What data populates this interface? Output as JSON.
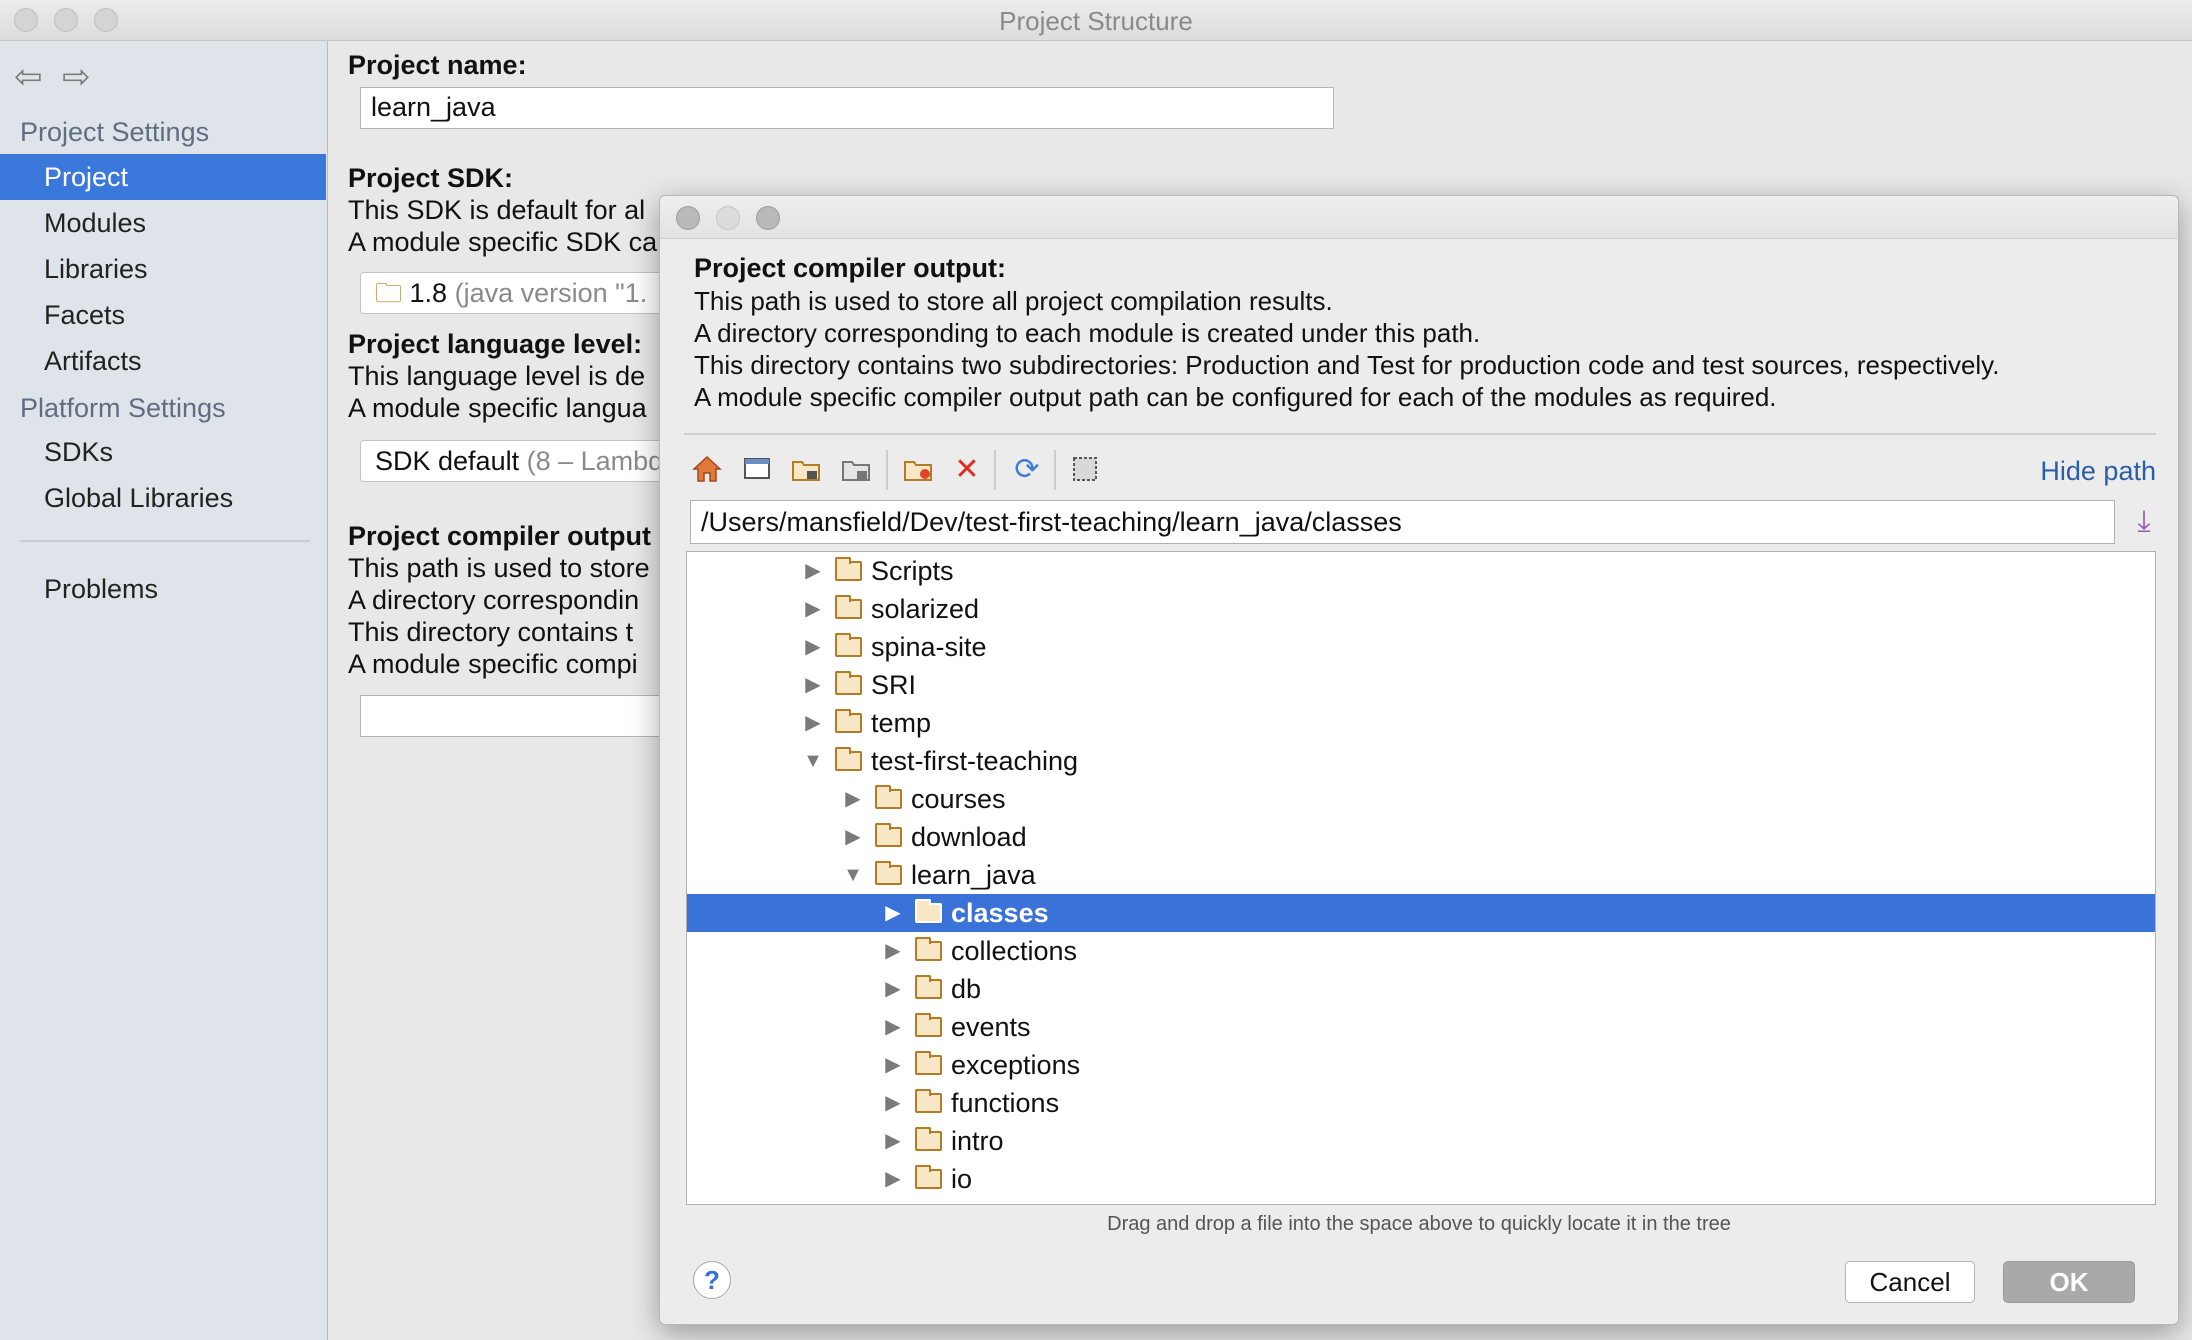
{
  "window": {
    "title": "Project Structure"
  },
  "sidebar": {
    "back_icon": "arrow-left-icon",
    "forward_icon": "arrow-right-icon",
    "project_settings_header": "Project Settings",
    "project_settings_items": [
      {
        "label": "Project",
        "selected": true
      },
      {
        "label": "Modules"
      },
      {
        "label": "Libraries"
      },
      {
        "label": "Facets"
      },
      {
        "label": "Artifacts"
      }
    ],
    "platform_settings_header": "Platform Settings",
    "platform_settings_items": [
      {
        "label": "SDKs"
      },
      {
        "label": "Global Libraries"
      }
    ],
    "problems_label": "Problems"
  },
  "main": {
    "project_name_label": "Project name:",
    "project_name_value": "learn_java",
    "sdk_label": "Project SDK:",
    "sdk_line1": "This SDK is default for al",
    "sdk_line2": "A module specific SDK ca",
    "sdk_value": "1.8",
    "sdk_value_muted": "(java version \"1.",
    "lang_label": "Project language level:",
    "lang_line1": "This language level is de",
    "lang_line2": "A module specific langua",
    "lang_value": "SDK default",
    "lang_value_muted": "(8 – Lambd",
    "compiler_label": "Project compiler output",
    "compiler_line1": "This path is used to store",
    "compiler_line2": "A directory correspondin",
    "compiler_line3": "This directory contains t",
    "compiler_line4": "A module specific compi",
    "compiler_value": ""
  },
  "dialog": {
    "title": "Project compiler output:",
    "lines": [
      "This path is used to store all project compilation results.",
      "A directory corresponding to each module is created under this path.",
      "This directory contains two subdirectories: Production and Test for production code and test sources, respectively.",
      "A module specific compiler output path can be configured for each of the modules as required."
    ],
    "toolbar_icons": [
      "home-icon",
      "desktop-icon",
      "project-folder-icon",
      "module-folder-icon",
      "new-folder-icon",
      "delete-icon",
      "refresh-icon",
      "show-hidden-icon"
    ],
    "hide_path_label": "Hide path",
    "path_value": "/Users/mansfield/Dev/test-first-teaching/learn_java/classes",
    "tree": [
      {
        "label": "Scripts",
        "expanded": false,
        "depth": 0
      },
      {
        "label": "solarized",
        "expanded": false,
        "depth": 0
      },
      {
        "label": "spina-site",
        "expanded": false,
        "depth": 0
      },
      {
        "label": "SRI",
        "expanded": false,
        "depth": 0
      },
      {
        "label": "temp",
        "expanded": false,
        "depth": 0
      },
      {
        "label": "test-first-teaching",
        "expanded": true,
        "depth": 0
      },
      {
        "label": "courses",
        "expanded": false,
        "depth": 1
      },
      {
        "label": "download",
        "expanded": false,
        "depth": 1
      },
      {
        "label": "learn_java",
        "expanded": true,
        "depth": 1
      },
      {
        "label": "classes",
        "expanded": false,
        "depth": 2,
        "selected": true
      },
      {
        "label": "collections",
        "expanded": false,
        "depth": 2
      },
      {
        "label": "db",
        "expanded": false,
        "depth": 2
      },
      {
        "label": "events",
        "expanded": false,
        "depth": 2
      },
      {
        "label": "exceptions",
        "expanded": false,
        "depth": 2
      },
      {
        "label": "functions",
        "expanded": false,
        "depth": 2
      },
      {
        "label": "intro",
        "expanded": false,
        "depth": 2
      },
      {
        "label": "io",
        "expanded": false,
        "depth": 2
      }
    ],
    "hint": "Drag and drop a file into the space above to quickly locate it in the tree",
    "help_label": "?",
    "cancel_label": "Cancel",
    "ok_label": "OK"
  },
  "colors": {
    "selection": "#3b78dc",
    "sidebar_bg": "#dfe4ea",
    "folder_stroke": "#b47a26",
    "link": "#2b5ea8"
  }
}
